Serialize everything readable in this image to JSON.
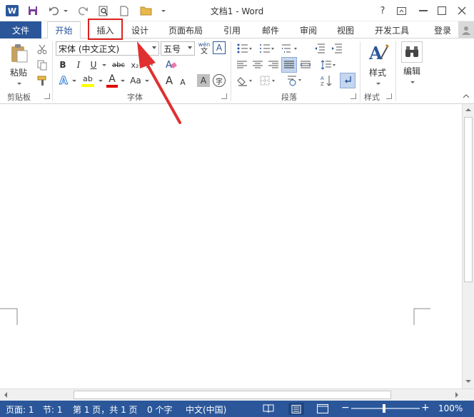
{
  "window": {
    "title": "文档1 - Word"
  },
  "qat": {
    "word_icon": "W",
    "save_icon": "save-icon",
    "undo_icon": "undo-icon",
    "redo_icon": "redo-icon"
  },
  "titlebar": {
    "help": "?"
  },
  "tabs": [
    "文件",
    "开始",
    "插入",
    "设计",
    "页面布局",
    "引用",
    "邮件",
    "审阅",
    "视图",
    "开发工具"
  ],
  "account": {
    "signin": "登录"
  },
  "ribbon": {
    "clipboard": {
      "paste_label": "粘贴",
      "group": "剪贴板"
    },
    "font": {
      "name": "宋体 (中文正文)",
      "size": "五号",
      "phonetic": "wén",
      "phonetic2": "文",
      "bold": "B",
      "italic": "I",
      "underline": "U",
      "strike": "abc",
      "sub": "x₂",
      "sup": "x²",
      "font_color": "A",
      "change_case": "Aa",
      "grow": "A",
      "shrink": "A",
      "char_border": "A",
      "enclose": "字",
      "highlight": "ab",
      "text_effect": "A",
      "group": "字体"
    },
    "paragraph": {
      "group": "段落"
    },
    "styles": {
      "label": "样式",
      "group": "样式"
    },
    "editing": {
      "label": "编辑"
    }
  },
  "status": {
    "page": "页面: 1",
    "section": "节: 1",
    "pages": "第 1 页，共 1 页",
    "words": "0 个字",
    "language": "中文(中国)",
    "zoom": "100%"
  },
  "colors": {
    "accent": "#2b579a",
    "highlight_box": "#e02020",
    "arrow": "#e03030"
  }
}
